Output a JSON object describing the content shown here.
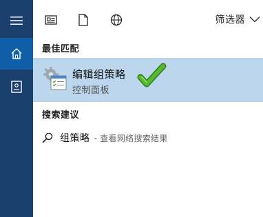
{
  "rail": {
    "icons": [
      "hamburger-menu-icon",
      "home-icon",
      "document-icon"
    ],
    "colors": {
      "background": "#1b3f6c",
      "active": "#0f5fa8"
    }
  },
  "toolbar": {
    "icons": [
      "news-icon",
      "file-icon",
      "globe-icon"
    ],
    "filter_label": "筛选器"
  },
  "best_match": {
    "heading": "最佳匹配",
    "title": "编辑组策略",
    "subtitle": "控制面板",
    "highlight_color": "#bcd6ee"
  },
  "suggestions": {
    "heading": "搜索建议",
    "items": [
      {
        "text": "组策略",
        "detail": "- 查看网络搜索结果"
      }
    ]
  }
}
